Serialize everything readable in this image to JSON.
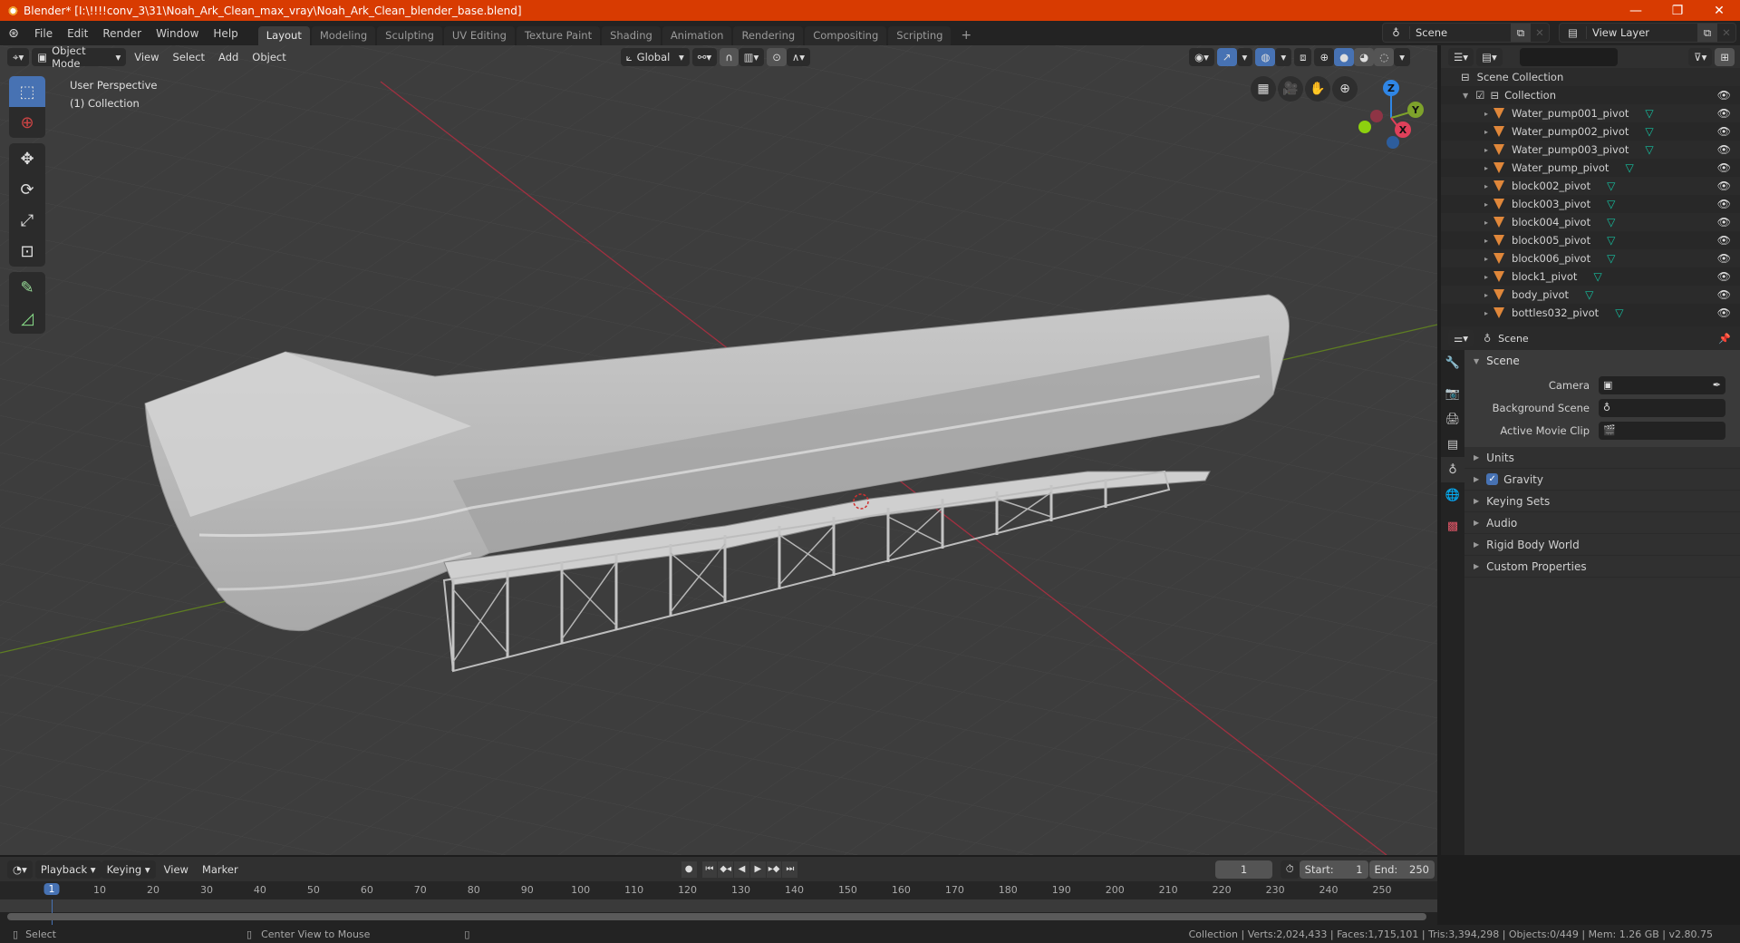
{
  "window": {
    "title": "Blender* [I:\\!!!!conv_3\\31\\Noah_Ark_Clean_max_vray\\Noah_Ark_Clean_blender_base.blend]",
    "minimize": "—",
    "maximize": "❐",
    "close": "✕"
  },
  "menu": [
    "File",
    "Edit",
    "Render",
    "Window",
    "Help"
  ],
  "workspaces": [
    "Layout",
    "Modeling",
    "Sculpting",
    "UV Editing",
    "Texture Paint",
    "Shading",
    "Animation",
    "Rendering",
    "Compositing",
    "Scripting"
  ],
  "workspace_add": "+",
  "scene_selector": {
    "value": "Scene"
  },
  "view_layer_selector": {
    "value": "View Layer"
  },
  "viewport": {
    "mode": "Object Mode",
    "menus": [
      "View",
      "Select",
      "Add",
      "Object"
    ],
    "orientation": "Global",
    "info_line1": "User Perspective",
    "info_line2": "(1) Collection",
    "gizmo": {
      "z": "Z",
      "y": "Y",
      "x": "X"
    },
    "colors": {
      "x_axis": "#e0405a",
      "y_axis": "#7ea22b",
      "z_axis": "#2f86e6",
      "active": "#4772b3"
    }
  },
  "outliner": {
    "search_placeholder": "",
    "root": "Scene Collection",
    "collection": "Collection",
    "items": [
      "Water_pump001_pivot",
      "Water_pump002_pivot",
      "Water_pump003_pivot",
      "Water_pump_pivot",
      "block002_pivot",
      "block003_pivot",
      "block004_pivot",
      "block005_pivot",
      "block006_pivot",
      "block1_pivot",
      "body_pivot",
      "bottles032_pivot"
    ]
  },
  "properties": {
    "context": "Scene",
    "panel_title": "Scene",
    "fields": [
      {
        "label": "Camera",
        "value": ""
      },
      {
        "label": "Background Scene",
        "value": ""
      },
      {
        "label": "Active Movie Clip",
        "value": ""
      }
    ],
    "subpanels": [
      "Units",
      "Gravity",
      "Keying Sets",
      "Audio",
      "Rigid Body World",
      "Custom Properties"
    ],
    "gravity_checked": true
  },
  "timeline": {
    "menus": [
      "Playback",
      "Keying",
      "View",
      "Marker"
    ],
    "current_frame": "1",
    "start_label": "Start:",
    "start": "1",
    "end_label": "End:",
    "end": "250",
    "ticks": [
      "1",
      "10",
      "20",
      "30",
      "40",
      "50",
      "60",
      "70",
      "80",
      "90",
      "100",
      "110",
      "120",
      "130",
      "140",
      "150",
      "160",
      "170",
      "180",
      "190",
      "200",
      "210",
      "220",
      "230",
      "240",
      "250"
    ]
  },
  "statusbar": {
    "left_action": "Select",
    "middle_action": "Center View to Mouse",
    "stats": "Collection | Verts:2,024,433 | Faces:1,715,101 | Tris:3,394,298 | Objects:0/449 | Mem: 1.26 GB | v2.80.75"
  }
}
